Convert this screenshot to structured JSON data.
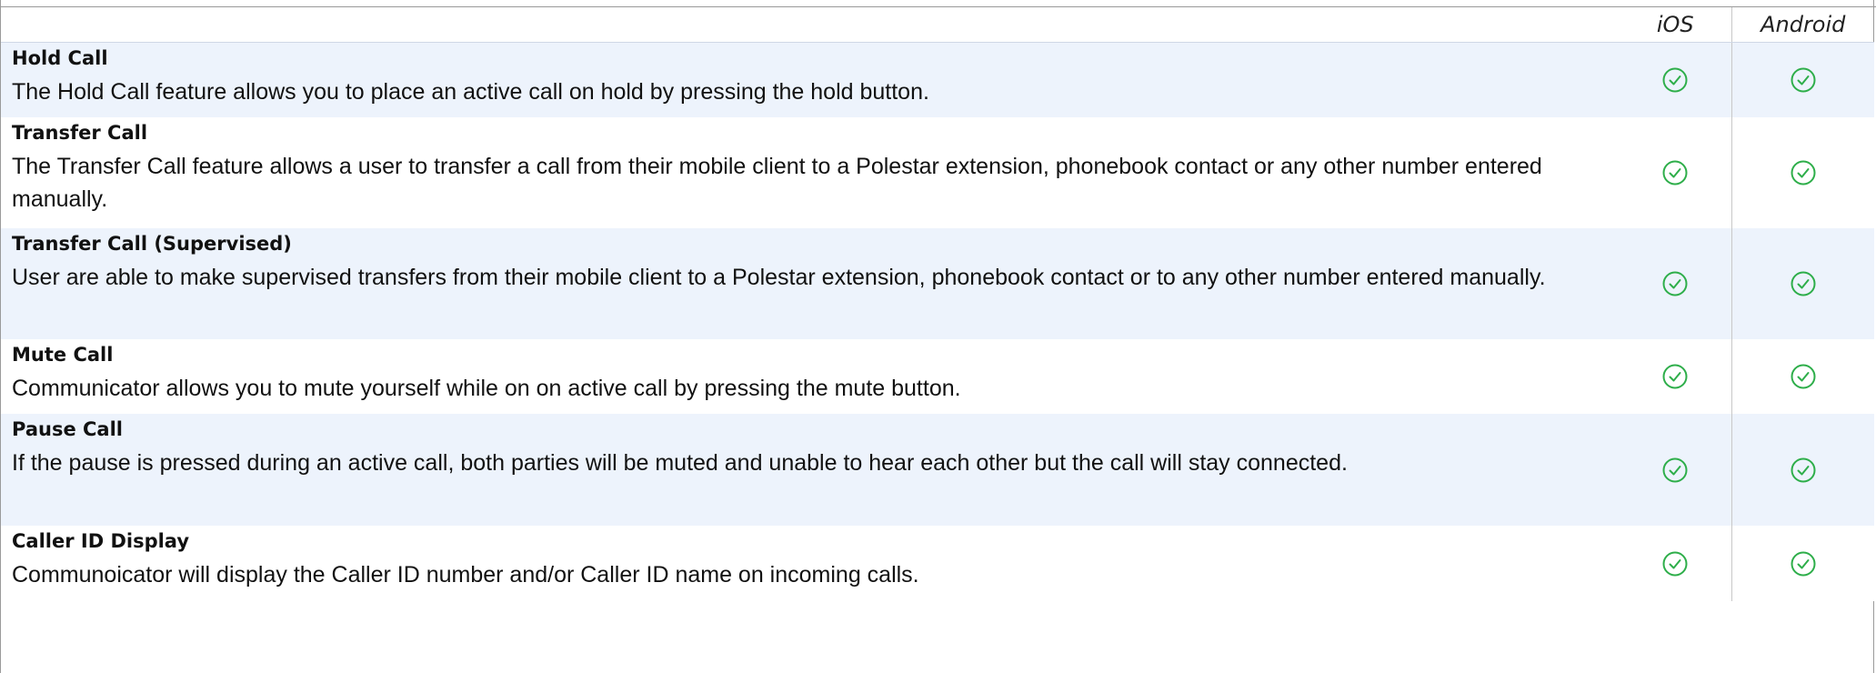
{
  "table": {
    "header": {
      "feature": "",
      "ios": "iOS",
      "android": "Android"
    },
    "rows": [
      {
        "name": "Hold Call",
        "description": "The Hold Call feature allows you to place an active call on hold by pressing the hold button.",
        "ios": "supported",
        "android": "supported"
      },
      {
        "name": "Transfer Call",
        "description": "The Transfer Call feature allows a user to transfer a call from their mobile client to a Polestar extension, phonebook contact or any other number entered manually.",
        "ios": "supported",
        "android": "supported"
      },
      {
        "name": "Transfer Call (Supervised)",
        "description": "User are able to make supervised transfers from their mobile client to a Polestar extension, phonebook contact or to any other number entered manually.",
        "ios": "supported",
        "android": "supported"
      },
      {
        "name": "Mute Call",
        "description": "Communicator allows you to mute yourself while on on active call by pressing the mute button.",
        "ios": "supported",
        "android": "supported"
      },
      {
        "name": "Pause Call",
        "description": "If the pause is pressed during an active call, both parties will be muted and unable to hear each other but the call will stay connected.",
        "ios": "supported",
        "android": "supported"
      },
      {
        "name": "Caller ID Display",
        "description": "Communoicator will display the Caller ID number and/or Caller ID name on incoming calls.",
        "ios": "supported",
        "android": "supported"
      }
    ]
  },
  "icons": {
    "supported": "check-circle-icon"
  },
  "colors": {
    "check_green": "#2eae4a",
    "row_shade": "#edf3fc"
  }
}
